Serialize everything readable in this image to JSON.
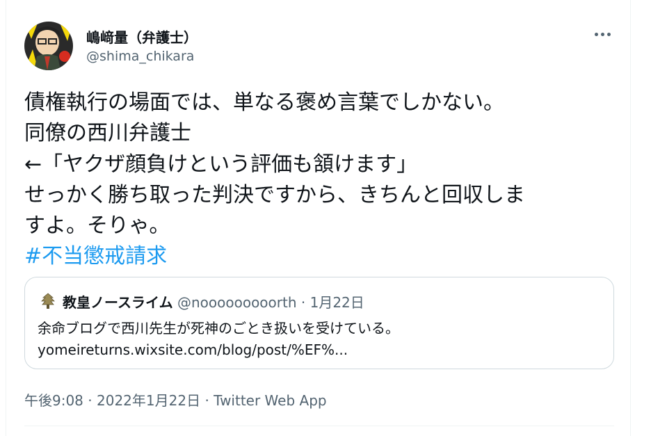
{
  "author": {
    "display_name": "嶋﨑量（弁護士）",
    "handle": "@shima_chikara"
  },
  "tweet": {
    "lines": [
      "債権執行の場面では、単なる褒め言葉でしかない。",
      "同僚の西川弁護士",
      "←「ヤクザ顔負けという評価も頷けます」",
      "せっかく勝ち取った判決ですから、きちんと回収しま",
      "すよ。そりゃ。"
    ],
    "hashtag": "#不当懲戒請求"
  },
  "quote": {
    "name": "教皇ノースライム",
    "handle": "@nooooooooorth",
    "date": "1月22日",
    "separator": "·",
    "text": "余命ブログで西川先生が死神のごとき扱いを受けている。",
    "link": "yomeireturns.wixsite.com/blog/post/%EF%..."
  },
  "meta": {
    "time": "午後9:08",
    "date": "2022年1月22日",
    "source": "Twitter Web App",
    "separator": "·"
  },
  "icons": {
    "more": "more-options-icon",
    "avatar": "profile-avatar-illustration",
    "quote_avatar": "tree-emblem-avatar"
  },
  "colors": {
    "link": "#1d9bf0",
    "secondary_text": "#536471",
    "primary_text": "#0f1419",
    "border": "#cfd9de"
  }
}
